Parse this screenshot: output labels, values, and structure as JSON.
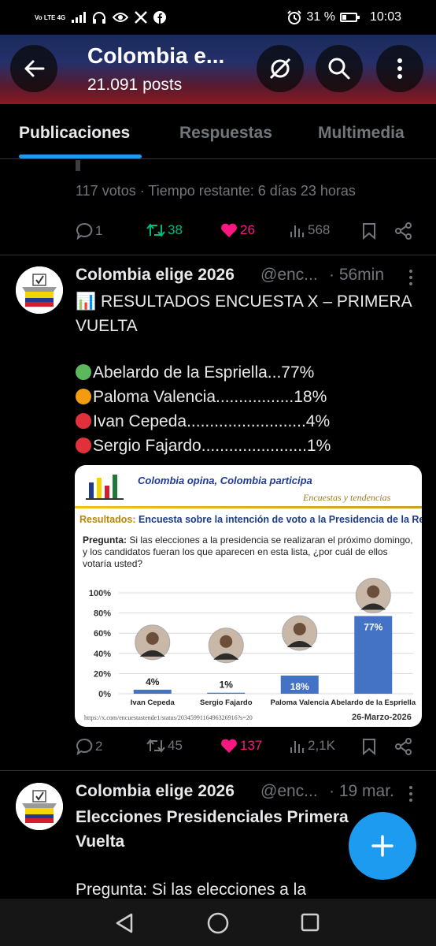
{
  "status_bar": {
    "network": "Vo LTE 4G",
    "battery": "31 %",
    "battery_level": 0.31,
    "time": "10:03"
  },
  "header": {
    "title": "Colombia e...",
    "posts_count": "21.091 posts"
  },
  "tabs": [
    {
      "label": "Publicaciones",
      "active": true
    },
    {
      "label": "Respuestas",
      "active": false
    },
    {
      "label": "Multimedia",
      "active": false
    }
  ],
  "poll_post": {
    "meta": "117 votos · Tiempo restante: 6 días 23 horas",
    "replies": "1",
    "reposts": "38",
    "likes": "26",
    "views": "568"
  },
  "post1": {
    "name": "Colombia elige 2026",
    "handle": "@enc...",
    "time": "· 56min",
    "line1": "RESULTADOS ENCUESTA X – PRIMERA VUELTA",
    "line1_icon": "📊",
    "candidates": [
      {
        "text": "Abelardo de la Espriella...77%",
        "color": "#5cb85c"
      },
      {
        "text": "Paloma Valencia.................18%",
        "color": "#f39c12"
      },
      {
        "text": "Ivan Cepeda..........................4%",
        "color": "#e0303a"
      },
      {
        "text": "Sergio Fajardo.......................1%",
        "color": "#e0303a"
      }
    ],
    "replies": "2",
    "reposts": "45",
    "likes": "137",
    "views": "2,1K"
  },
  "card": {
    "opina": "Colombia opina, Colombia participa",
    "tendencias": "Encuestas y tendencias",
    "resultados_label": "Resultados:",
    "resultados_text": "Encuesta sobre la intención de voto a la  Presidencia de la Republica",
    "pregunta_label": "Pregunta:",
    "pregunta_text": "Si las elecciones a la presidencia se realizaran el próximo domingo, y los candidatos fueran los que aparecen en esta lista, ¿por cuál de ellos votaría usted?",
    "link": "https://x.com/encuestastende1/status/2034599116496326916?s=20",
    "date": "26-Marzo-2026"
  },
  "chart_data": {
    "type": "bar",
    "categories": [
      "Ivan Cepeda",
      "Sergio Fajardo",
      "Paloma Valencia",
      "Abelardo de la Espriella"
    ],
    "values": [
      4,
      1,
      18,
      77
    ],
    "labels": [
      "4%",
      "1%",
      "18%",
      "77%"
    ],
    "ylim": [
      0,
      100
    ],
    "yticks": [
      "0%",
      "20%",
      "40%",
      "60%",
      "80%",
      "100%"
    ],
    "bar_color": "#4472c4",
    "grid": true,
    "title": "",
    "xlabel": "",
    "ylabel": ""
  },
  "post2": {
    "name": "Colombia elige 2026",
    "handle": "@enc...",
    "time": "· 19 mar.",
    "title": "Elecciones Presidenciales Primera Vuelta",
    "body": "Pregunta: Si las elecciones a la"
  },
  "colors": {
    "accent": "#1d9bf0",
    "repost_active": "#00ba7c",
    "like_active": "#f91880",
    "muted": "#71767b"
  }
}
